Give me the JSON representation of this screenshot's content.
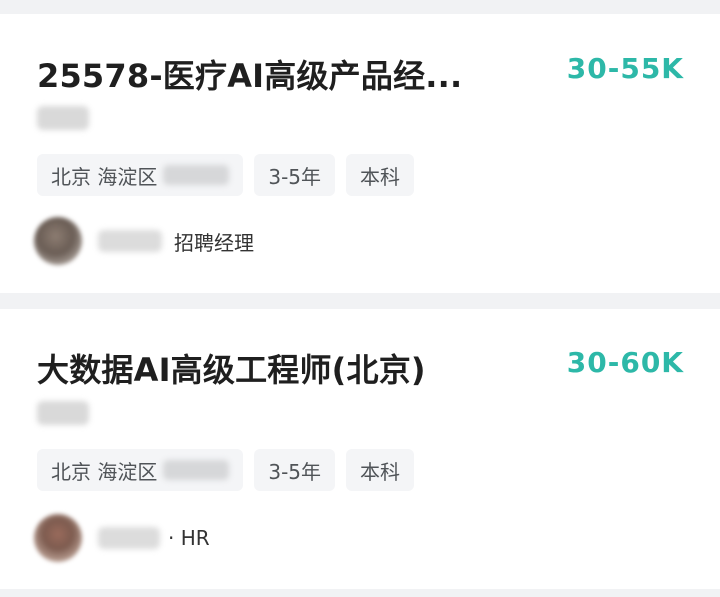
{
  "jobs": [
    {
      "title": "25578-医疗AI高级产品经...",
      "salary": "30-55K",
      "tags": {
        "location": "北京 海淀区",
        "experience": "3-5年",
        "education": "本科"
      },
      "recruiter_role": "招聘经理"
    },
    {
      "title": "大数据AI高级工程师(北京)",
      "salary": "30-60K",
      "tags": {
        "location": "北京 海淀区",
        "experience": "3-5年",
        "education": "本科"
      },
      "recruiter_role": "· HR"
    }
  ],
  "colors": {
    "salary": "#2db8a8",
    "background": "#f1f2f4",
    "card": "#ffffff"
  }
}
